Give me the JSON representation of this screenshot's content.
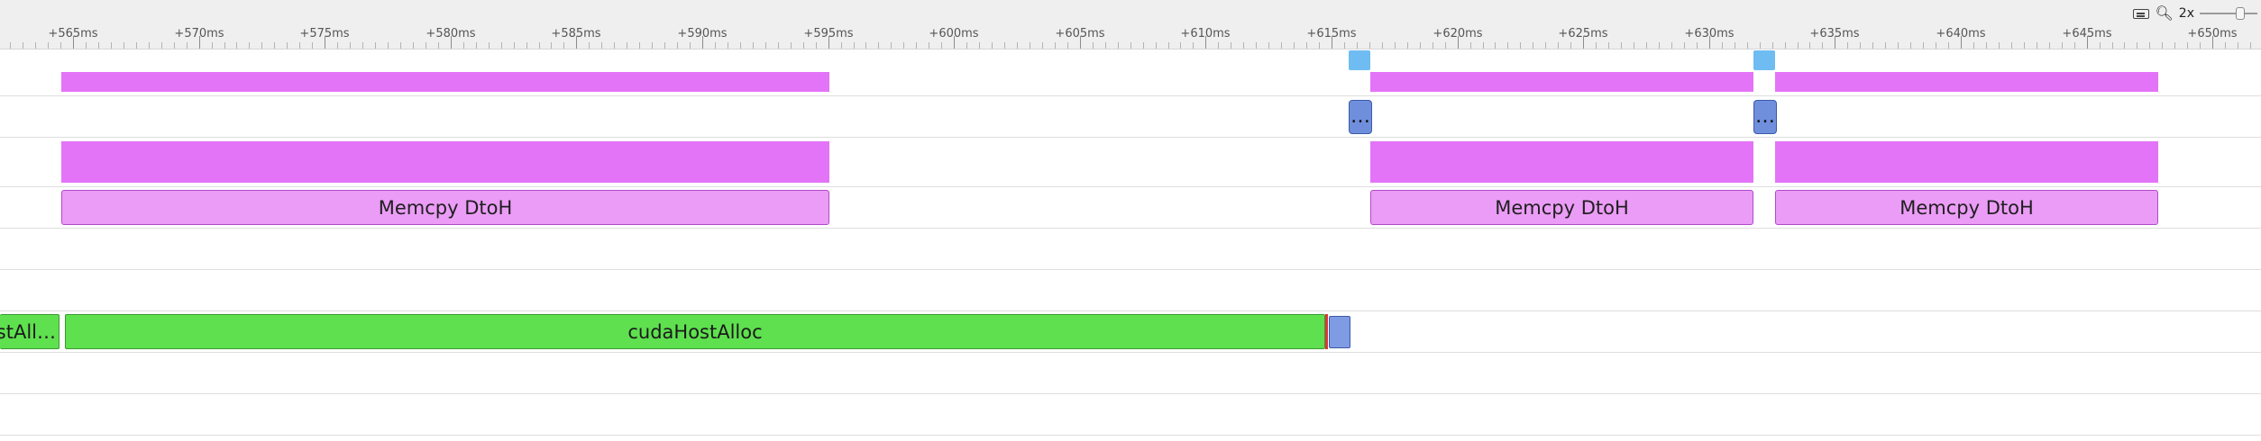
{
  "ruler": {
    "ticks": [
      "+565ms",
      "+570ms",
      "+575ms",
      "+580ms",
      "+585ms",
      "+590ms",
      "+595ms",
      "+600ms",
      "+605ms",
      "+610ms",
      "+615ms",
      "+620ms",
      "+625ms",
      "+630ms",
      "+635ms",
      "+640ms",
      "+645ms",
      "+650ms"
    ]
  },
  "zoom": {
    "level": "2x",
    "keyboard_icon": "keyboard-icon",
    "zoom_icon": "zoom-out-icon"
  },
  "events": {
    "memcpy_1": "Memcpy DtoH",
    "memcpy_2": "Memcpy DtoH",
    "memcpy_3": "Memcpy DtoH",
    "ellipsis_1": "…",
    "ellipsis_2": "…",
    "cuda_left": "stAll…",
    "cuda_main": "cudaHostAlloc"
  },
  "colors": {
    "kernel_magenta": "#e374f7",
    "memcpy_pink": "#eb9cf6",
    "api_green": "#5ee04f",
    "marker_blue": "#6fbcf3",
    "group_blue": "#6f8fdd",
    "error_red": "#d93838"
  }
}
